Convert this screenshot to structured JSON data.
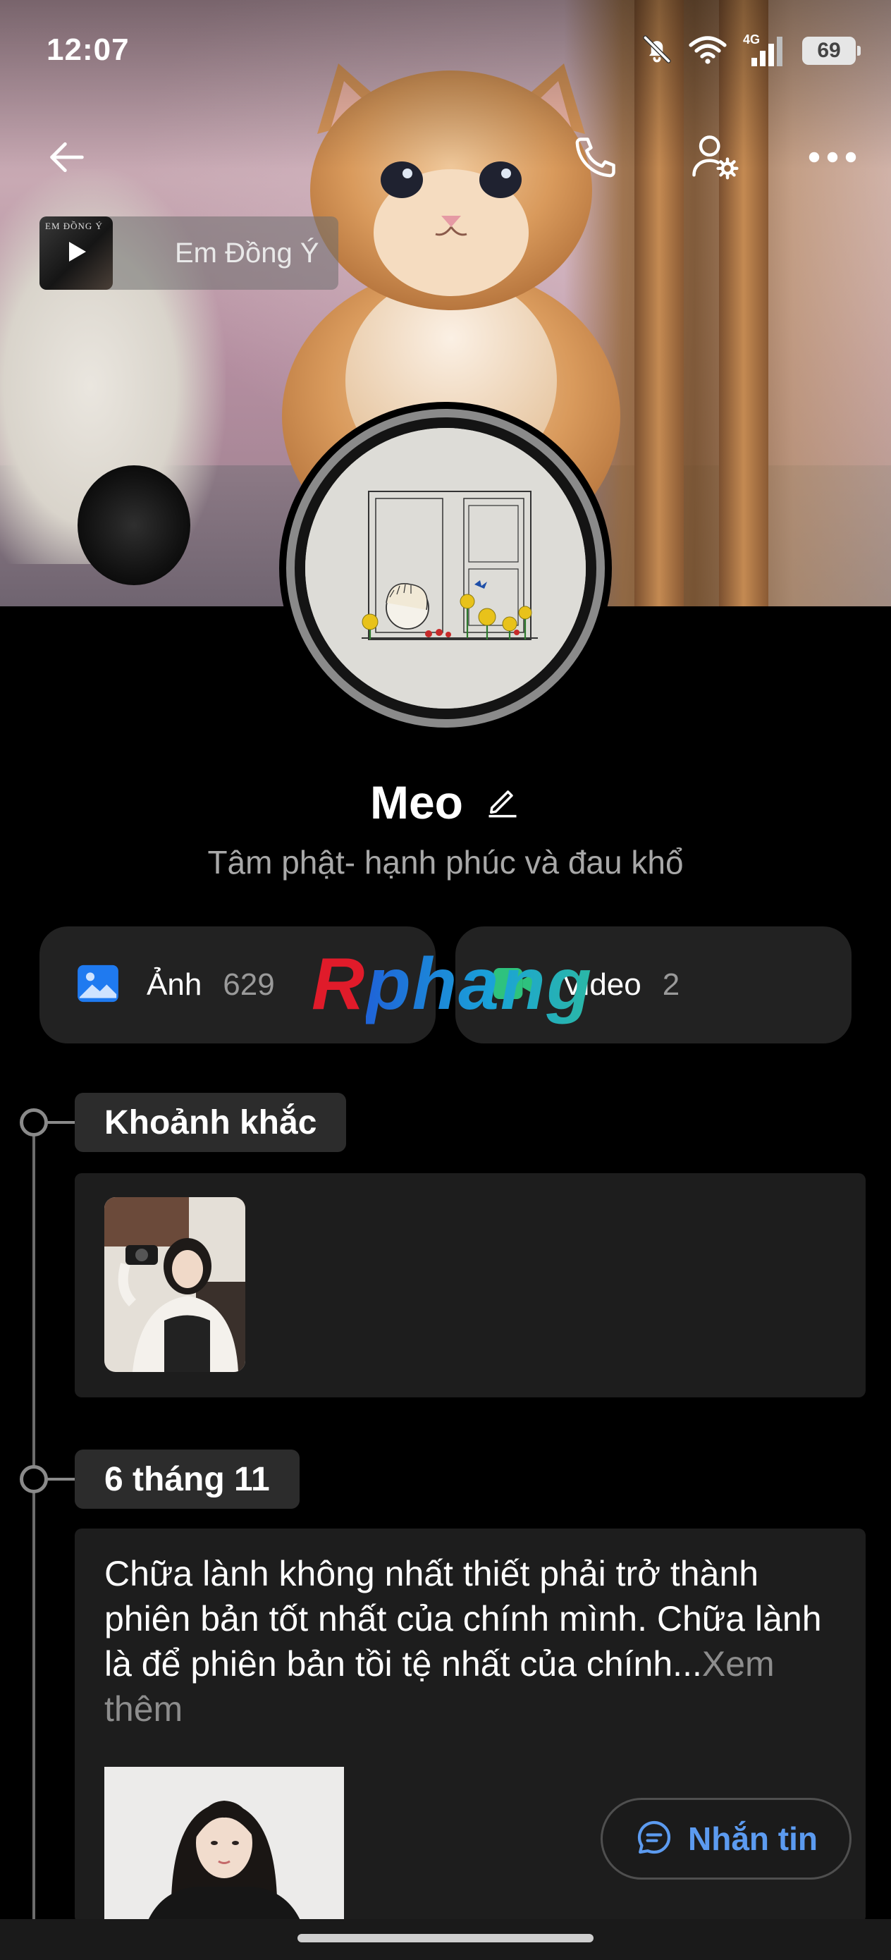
{
  "status_bar": {
    "time": "12:07",
    "network": "4G",
    "battery": "69",
    "icons": [
      "bell-off-icon",
      "wifi-icon",
      "signal-icon",
      "battery-icon"
    ]
  },
  "header": {
    "back_icon": "arrow-left-icon",
    "call_icon": "phone-icon",
    "settings_icon": "user-settings-icon",
    "more_icon": "more-horizontal-icon"
  },
  "music": {
    "title": "Em Đồng Ý",
    "thumb_label": "EM ĐỒNG Ý"
  },
  "profile": {
    "name": "Meo",
    "bio": "Tâm phật- hạnh phúc và đau khổ"
  },
  "media": {
    "photos_label": "Ảnh",
    "photos_count": "629",
    "videos_label": "Video",
    "videos_count": "2"
  },
  "watermark": {
    "first": "R",
    "rest": "phang"
  },
  "timeline": {
    "moments_header": "Khoảnh khắc",
    "post_date": "6 tháng 11",
    "post_text": "Chữa lành không nhất thiết phải trở thành phiên bản tốt nhất của chính mình. Chữa lành là để phiên bản tồi tệ nhất của chính...",
    "post_more": "Xem thêm"
  },
  "actions": {
    "message_label": "Nhắn tin"
  },
  "colors": {
    "background": "#000000",
    "card": "#1d1d1d",
    "tile": "#222222",
    "accent_blue": "#5c9bf0",
    "photo_icon_blue": "#1f7af0",
    "video_icon_green": "#2ec27e"
  }
}
